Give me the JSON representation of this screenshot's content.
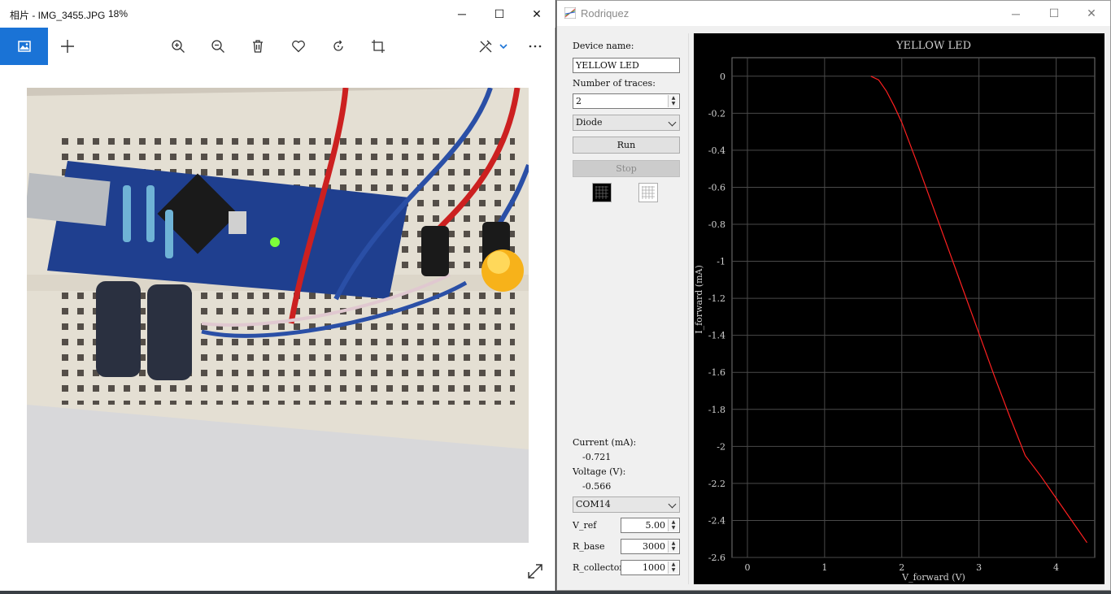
{
  "photos": {
    "title": "相片 - IMG_3455.JPG",
    "zoom": "18%",
    "window_buttons": {
      "minimize": "─",
      "maximize": "☐",
      "close": "✕"
    }
  },
  "rodriquez": {
    "title": "Rodriquez",
    "window_buttons": {
      "minimize": "─",
      "maximize": "☐",
      "close": "✕"
    },
    "panel": {
      "device_name_label": "Device name:",
      "device_name_value": "YELLOW LED",
      "traces_label": "Number of traces:",
      "traces_value": "2",
      "device_type": "Diode",
      "run_label": "Run",
      "stop_label": "Stop",
      "current_label": "Current (mA):",
      "current_value": "-0.721",
      "voltage_label": "Voltage (V):",
      "voltage_value": "-0.566",
      "port": "COM14",
      "vref_label": "V_ref",
      "vref_value": "5.00",
      "rbase_label": "R_base",
      "rbase_value": "3000",
      "rcoll_label": "R_collector",
      "rcoll_value": "1000",
      "spin_up": "▲",
      "spin_down": "▼"
    }
  },
  "colors": {
    "accent": "#1a73d6",
    "trace": "#ff2020",
    "plot_bg": "#000000",
    "grid": "#4a4a4a"
  },
  "chart_data": {
    "type": "line",
    "title": "YELLOW LED",
    "xlabel": "V_forward (V)",
    "ylabel": "I_forward (mA)",
    "xlim": [
      -0.2,
      4.5
    ],
    "ylim": [
      -2.6,
      0.1
    ],
    "xticks": [
      "0",
      "1",
      "2",
      "3",
      "4"
    ],
    "xtick_values": [
      0,
      1,
      2,
      3,
      4
    ],
    "yticks": [
      "0",
      "-0.2",
      "-0.4",
      "-0.6",
      "-0.8",
      "-1",
      "-1.2",
      "-1.4",
      "-1.6",
      "-1.8",
      "-2",
      "-2.2",
      "-2.4",
      "-2.6"
    ],
    "ytick_values": [
      0,
      -0.2,
      -0.4,
      -0.6,
      -0.8,
      -1,
      -1.2,
      -1.4,
      -1.6,
      -1.8,
      -2,
      -2.2,
      -2.4,
      -2.6
    ],
    "grid": true,
    "series": [
      {
        "color": "#ff2020",
        "x": [
          1.6,
          1.7,
          1.8,
          1.9,
          2.0,
          2.2,
          2.4,
          2.6,
          2.8,
          3.0,
          3.2,
          3.4,
          3.6,
          3.8,
          4.0,
          4.2,
          4.4
        ],
        "y": [
          0.0,
          -0.02,
          -0.08,
          -0.16,
          -0.25,
          -0.47,
          -0.7,
          -0.93,
          -1.16,
          -1.39,
          -1.62,
          -1.84,
          -2.05,
          -2.16,
          -2.28,
          -2.4,
          -2.52
        ]
      }
    ]
  }
}
